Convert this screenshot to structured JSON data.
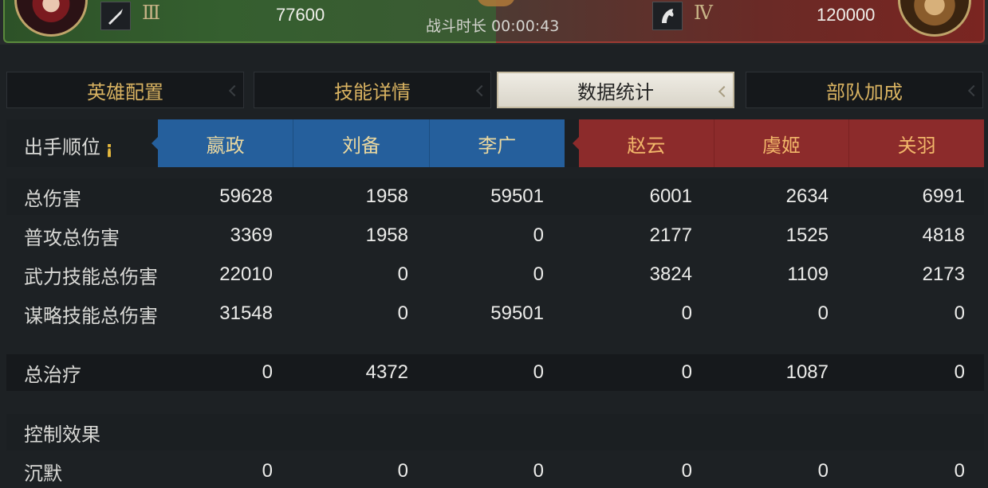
{
  "banner": {
    "left_tier": "Ⅲ",
    "left_troops": "77600",
    "right_tier": "Ⅳ",
    "right_troops": "120000",
    "duration": "战斗时长 00:00:43",
    "left_unit_icon": "spear-icon",
    "right_unit_icon": "horse-icon"
  },
  "tabs": [
    {
      "label": "英雄配置",
      "active": false
    },
    {
      "label": "技能详情",
      "active": false
    },
    {
      "label": "数据统计",
      "active": true
    },
    {
      "label": "部队加成",
      "active": false
    }
  ],
  "stats": {
    "order_label": "出手顺位",
    "heroes": [
      "嬴政",
      "刘备",
      "李广",
      "赵云",
      "虞姬",
      "关羽"
    ],
    "rows": [
      {
        "label": "总伤害",
        "values": [
          "59628",
          "1958",
          "59501",
          "6001",
          "2634",
          "6991"
        ]
      },
      {
        "label": "普攻总伤害",
        "values": [
          "3369",
          "1958",
          "0",
          "2177",
          "1525",
          "4818"
        ]
      },
      {
        "label": "武力技能总伤害",
        "values": [
          "22010",
          "0",
          "0",
          "3824",
          "1109",
          "2173"
        ]
      },
      {
        "label": "谋略技能总伤害",
        "values": [
          "31548",
          "0",
          "59501",
          "0",
          "0",
          "0"
        ]
      },
      {
        "label": "总治疗",
        "values": [
          "0",
          "4372",
          "0",
          "0",
          "1087",
          "0"
        ]
      },
      {
        "label": "控制效果",
        "values": []
      },
      {
        "label": "沉默",
        "values": [
          "0",
          "0",
          "0",
          "0",
          "0",
          "0"
        ]
      }
    ]
  },
  "colors": {
    "ally": "#255f9c",
    "enemy": "#8c2b2b",
    "tab_text": "#d8b261"
  }
}
